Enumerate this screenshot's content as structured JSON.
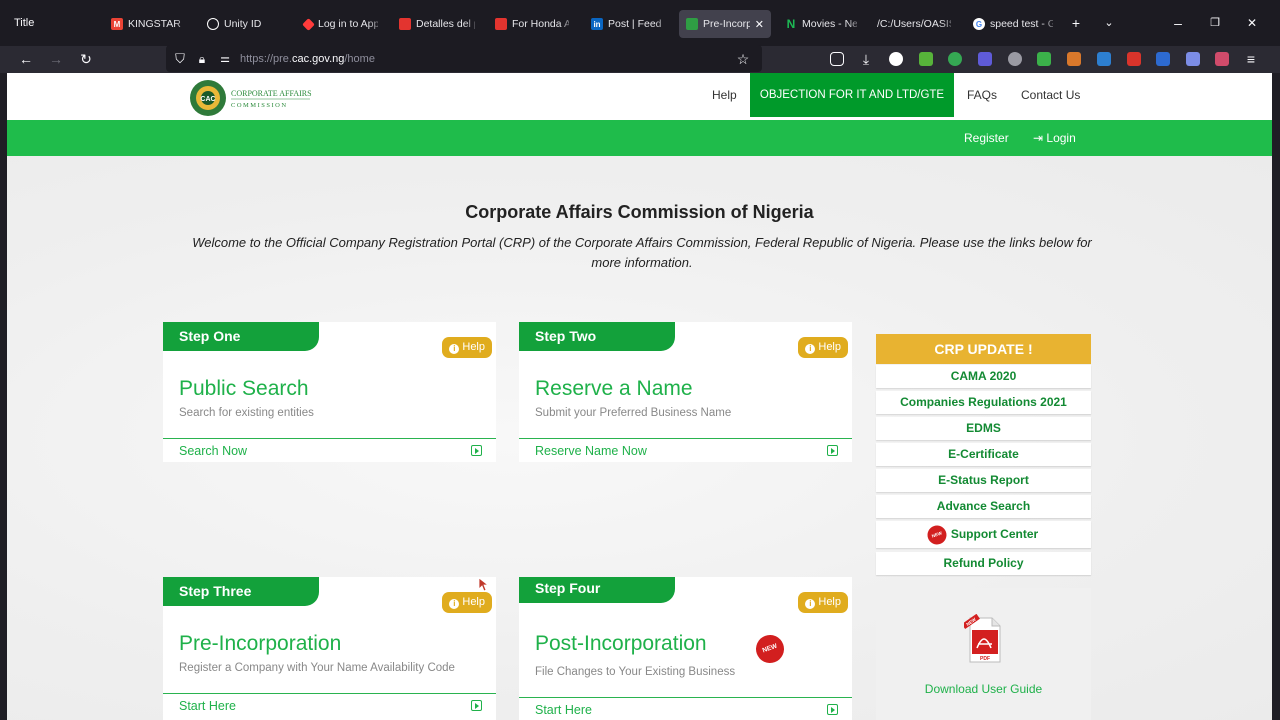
{
  "browser": {
    "window_title": "Title",
    "tabs": [
      {
        "label": "KINGSTAR",
        "fav_color": "#ea4335"
      },
      {
        "label": "Unity ID",
        "fav_color": "#ffffff"
      },
      {
        "label": "Log in to App",
        "fav_color": "#ff3b3b"
      },
      {
        "label": "Detalles del p",
        "fav_color": "#e3342f"
      },
      {
        "label": "For Honda Ac",
        "fav_color": "#e3342f"
      },
      {
        "label": "Post | Feed | L",
        "fav_color": "#0a66c2"
      },
      {
        "label": "Pre-Incorpo",
        "fav_color": "#2f9e44",
        "active": true
      },
      {
        "label": "Movies - Netn",
        "fav_color": "#1db954"
      },
      {
        "label": "/C:/Users/OASIS/",
        "fav_color": "#42414d"
      },
      {
        "label": "speed test - G",
        "fav_color": "#4285f4"
      }
    ],
    "url_prefix": "https://pre.",
    "url_host": "cac.gov.ng",
    "url_path": "/home",
    "accent": "#42414d"
  },
  "site": {
    "brand_primary": "#1fbc4b",
    "brand_dark": "#009a2a",
    "header": {
      "logo_line1": "CORPORATE AFFAIRS",
      "logo_line2": "COMMISSION",
      "logo_seal": "CAC",
      "nav": {
        "help": "Help",
        "objection": "OBJECTION FOR IT AND LTD/GTE",
        "faqs": "FAQs",
        "contact": "Contact Us"
      }
    },
    "subnav": {
      "register": "Register",
      "login": "Login"
    },
    "title": "Corporate Affairs Commission of Nigeria",
    "welcome": "Welcome to the Official Company Registration Portal (CRP) of the Corporate Affairs Commission, Federal Republic of Nigeria. Please use the links below for more information.",
    "steps": [
      {
        "step": "Step One",
        "title": "Public Search",
        "subtitle": "Search for existing entities",
        "link": "Search Now",
        "help": "Help"
      },
      {
        "step": "Step Two",
        "title": "Reserve a Name",
        "subtitle": "Submit your Preferred Business Name",
        "link": "Reserve Name Now",
        "help": "Help"
      },
      {
        "step": "Step Three",
        "title": "Pre-Incorporation",
        "subtitle": "Register a Company with Your Name Availability Code",
        "link": "Start Here",
        "help": "Help"
      },
      {
        "step": "Step Four",
        "title": "Post-Incorporation",
        "subtitle": "File Changes to Your Existing Business",
        "link": "Start Here",
        "help": "Help",
        "badge": "NEW"
      }
    ],
    "crp_update": {
      "heading": "CRP UPDATE !",
      "items": [
        "CAMA 2020",
        "Companies Regulations 2021",
        "EDMS",
        "E-Certificate",
        "E-Status Report",
        "Advance Search",
        "Support Center",
        "Refund Policy"
      ],
      "support_badge": "NEW"
    },
    "guide": {
      "label": "Download User Guide",
      "icon_text": "PDF",
      "icon_badge": "NEW"
    }
  }
}
